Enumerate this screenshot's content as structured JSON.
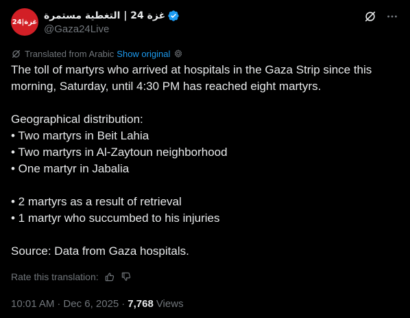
{
  "colors": {
    "background": "#000000",
    "text": "#e7e9ea",
    "secondary": "#71767b",
    "link": "#1d9bf0",
    "avatar_bg": "#d21f26",
    "verified": "#1d9bf0"
  },
  "author": {
    "display_name": "غزة 24 | التغطية مستمرة",
    "handle": "@Gaza24Live",
    "avatar_text": "غزة|24",
    "verified_icon": "verified-badge-icon"
  },
  "header_actions": {
    "grok_icon": "grok-icon",
    "more_icon": "more-icon"
  },
  "translation": {
    "label": "Translated from Arabic",
    "show_original": "Show original",
    "settings_icon": "gear-icon"
  },
  "tweet": {
    "line1": "The toll of martyrs who arrived at hospitals in the Gaza Strip since this morning, Saturday, until 4:30 PM has reached eight martyrs.",
    "geo_heading": "Geographical distribution:",
    "geo_items": [
      "• Two martyrs in Beit Lahia",
      "• Two martyrs in Al-Zaytoun neighborhood",
      "• One martyr in Jabalia"
    ],
    "cause_items": [
      "• 2 martyrs as a result of retrieval",
      "• 1 martyr who succumbed to his injuries"
    ],
    "source": "Source: Data from Gaza hospitals."
  },
  "rate": {
    "label": "Rate this translation:"
  },
  "meta": {
    "time": "10:01 AM",
    "date": "Dec 6, 2025",
    "separator": "·",
    "views_count": "7,768",
    "views_label": "Views"
  }
}
